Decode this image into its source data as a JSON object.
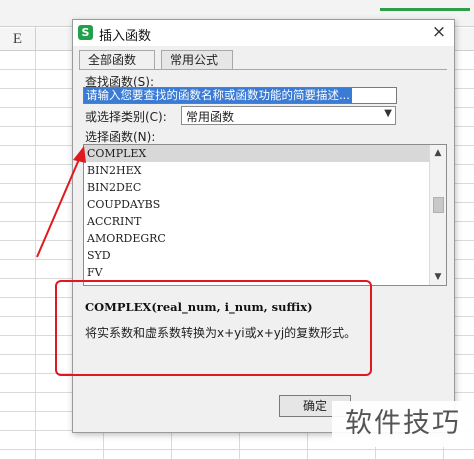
{
  "sheet": {
    "column_label": "E"
  },
  "dialog": {
    "title": "插入函数",
    "app_icon_glyph": "S",
    "close_glyph": "×",
    "tabs": [
      {
        "label": "全部函数",
        "active": true
      },
      {
        "label": "常用公式",
        "active": false
      }
    ],
    "search_label": "查找函数(S):",
    "search_value": "请输入您要查找的函数名称或函数功能的简要描述...",
    "category_label": "或选择类别(C):",
    "category_value": "常用函数",
    "function_label": "选择函数(N):",
    "functions": [
      "COMPLEX",
      "BIN2HEX",
      "BIN2DEC",
      "COUPDAYBS",
      "ACCRINT",
      "AMORDEGRC",
      "SYD",
      "FV"
    ],
    "selected_function": "COMPLEX",
    "signature": "COMPLEX(real_num, i_num, suffix)",
    "description": "将实系数和虚系数转换为x+yi或x+yj的复数形式。",
    "ok_label": "确定"
  },
  "watermark": "软件技巧",
  "colors": {
    "annotation_red": "#e0191e",
    "selection_blue": "#3a7bd5",
    "app_green": "#22a04b"
  },
  "icons": [
    "app-logo-icon",
    "close-icon",
    "dropdown-arrow-icon",
    "scroll-up-icon",
    "scroll-down-icon"
  ]
}
